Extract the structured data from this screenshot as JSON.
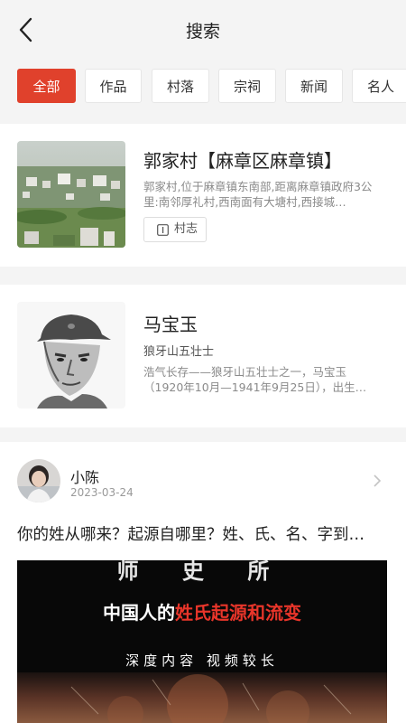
{
  "header": {
    "title": "搜索"
  },
  "tabs": [
    "全部",
    "作品",
    "村落",
    "宗祠",
    "新闻",
    "名人"
  ],
  "results": {
    "village": {
      "title": "郭家村【麻章区麻章镇】",
      "description": "郭家村,位于麻章镇东南部,距离麻章镇政府3公里:南邻厚礼村,西南面有大塘村,西接城…",
      "tag": "村志"
    },
    "person": {
      "name": "马宝玉",
      "subtitle": "狼牙山五壮士",
      "description": "浩气长存——狼牙山五壮士之一，马宝玉（1920年10月—1941年9月25日），出生…"
    },
    "post": {
      "author": "小陈",
      "date": "2023-03-24",
      "title": "你的姓从哪来？起源自哪里？姓、氏、名、字到…",
      "video_line1": "师 史 所",
      "video_line2_prefix": "中国人的",
      "video_line2_highlight": "姓氏起源和流变",
      "video_line3": "深度内容    视频较长"
    }
  },
  "colors": {
    "accent": "#e0412c",
    "background": "#f4f4f4"
  }
}
